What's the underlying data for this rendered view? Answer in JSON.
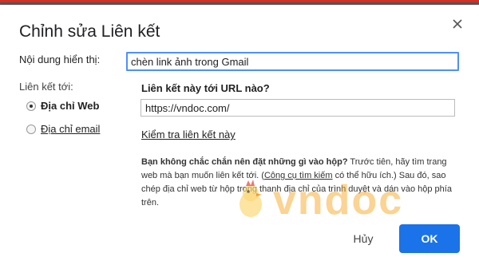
{
  "dialog": {
    "title": "Chỉnh sửa Liên kết",
    "close_icon": "close-icon"
  },
  "display_text": {
    "label": "Nội dung hiển thị:",
    "value": "chèn link ảnh trong Gmail"
  },
  "link_to": {
    "label": "Liên kết tới:",
    "options": [
      {
        "label": "Địa chỉ Web",
        "selected": true
      },
      {
        "label": "Địa chỉ email",
        "selected": false
      }
    ]
  },
  "url": {
    "question": "Liên kết này tới URL nào?",
    "value": "https://vndoc.com/"
  },
  "test_link": "Kiểm tra liên kết này",
  "help": {
    "lead": "Bạn không chắc chắn nên đặt những gì vào hộp?",
    "part1": " Trước tiên, hãy tìm trang web mà bạn muốn liên kết tới. (",
    "search_link": "Công cụ tìm kiếm",
    "part2": " có thể hữu ích.) Sau đó, sao chép địa chỉ web từ hộp trong thanh địa chỉ của trình duyệt và dán vào hộp phía trên."
  },
  "watermark": {
    "text": "vndoc",
    "mascot_icon": "chick-mascot-icon"
  },
  "buttons": {
    "cancel": "Hủy",
    "ok": "OK"
  },
  "colors": {
    "primary": "#1a73e8",
    "focus_border": "#4d90fe",
    "watermark": "#f5a623"
  }
}
